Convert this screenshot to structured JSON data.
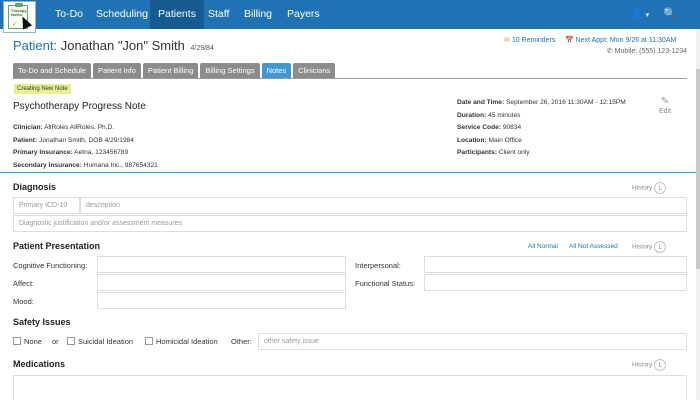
{
  "app": {
    "logo_text": "Therapy Notes",
    "nav": [
      {
        "label": "To-Do"
      },
      {
        "label": "Scheduling"
      },
      {
        "label": "Patients"
      },
      {
        "label": "Staff"
      },
      {
        "label": "Billing"
      },
      {
        "label": "Payers"
      }
    ],
    "active_nav": "Patients",
    "user_icon": "user-icon",
    "search_icon": "search-icon"
  },
  "patient": {
    "label": "Patient:",
    "name": "Jonathan \"Jon\" Smith",
    "dob": "4/29/84",
    "reminders": "10 Reminders",
    "next_appt": "Next Appt: Mon 9/26 at 11:30AM",
    "mobile": "Mobile: (555) 123-1234"
  },
  "tabs": [
    "To-Do and Schedule",
    "Patient Info",
    "Patient Billing",
    "Billing Settings",
    "Notes",
    "Clinicians"
  ],
  "active_tab": "Notes",
  "creating_badge": "Creating New Note",
  "note": {
    "title": "Psychotherapy Progress Note",
    "clinician_lbl": "Clinician:",
    "clinician": "AllRoles AllRoles, Ph.D.",
    "patient_lbl": "Patient:",
    "patient": "Jonathan Smith, DOB 4/29/1984",
    "primary_ins_lbl": "Primary Insurance:",
    "primary_ins": "Aetna, 123456789",
    "secondary_ins_lbl": "Secondary Insurance:",
    "secondary_ins": "Humana Inc., 987654321",
    "datetime_lbl": "Date and Time:",
    "datetime": "September 26, 2016 11:30AM - 12:15PM",
    "duration_lbl": "Duration:",
    "duration": "45 minutes",
    "service_lbl": "Service Code:",
    "service": "90834",
    "location_lbl": "Location:",
    "location": "Main Office",
    "participants_lbl": "Participants:",
    "participants": "Client only",
    "edit_label": "Edit"
  },
  "diagnosis": {
    "title": "Diagnosis",
    "history": "History",
    "primary_icd_placeholder": "Primary ICD-10",
    "description_placeholder": "description",
    "justification_placeholder": "Diagnostic justification and/or assessment measures"
  },
  "presentation": {
    "title": "Patient Presentation",
    "all_normal": "All Normal",
    "all_not_assessed": "All Not Assessed",
    "history": "History",
    "cognitive": "Cognitive Functioning:",
    "affect": "Affect:",
    "mood": "Mood:",
    "interpersonal": "Interpersonal:",
    "functional": "Functional Status:"
  },
  "safety": {
    "title": "Safety Issues",
    "none": "None",
    "or": "or",
    "suicidal": "Suicidal Ideation",
    "homicidal": "Homicidal Ideation",
    "other_lbl": "Other:",
    "other_placeholder": "other safety issue"
  },
  "medications": {
    "title": "Medications",
    "history": "History"
  }
}
